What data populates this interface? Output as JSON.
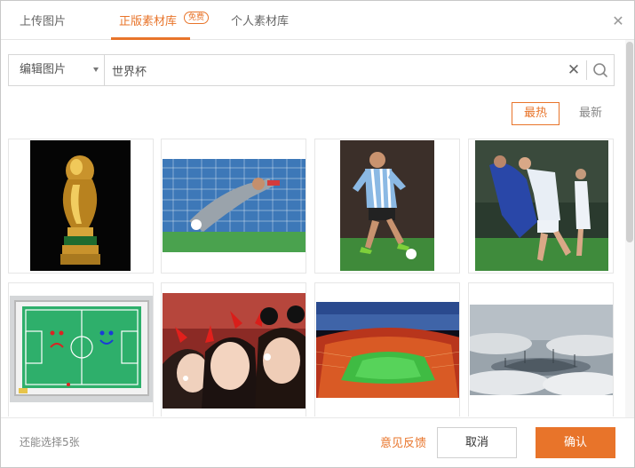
{
  "tabs": [
    {
      "label": "上传图片",
      "active": false
    },
    {
      "label": "正版素材库",
      "active": true,
      "badge": "免费"
    },
    {
      "label": "个人素材库",
      "active": false
    }
  ],
  "close_icon": "close-icon",
  "search": {
    "category": "编辑图片",
    "query": "世界杯"
  },
  "sort": {
    "hot": "最热",
    "new": "最新",
    "active": "最热"
  },
  "images": [
    {
      "subject": "world-cup-trophy"
    },
    {
      "subject": "goalkeeper-dive"
    },
    {
      "subject": "player-dribbling"
    },
    {
      "subject": "headbutt-match"
    },
    {
      "subject": "tactics-board"
    },
    {
      "subject": "fans-with-horns"
    },
    {
      "subject": "stadium-night"
    },
    {
      "subject": "stadium-in-clouds"
    }
  ],
  "footer": {
    "remaining": "还能选择5张",
    "feedback": "意见反馈",
    "cancel": "取消",
    "confirm": "确认"
  },
  "colors": {
    "accent": "#e8742a",
    "border": "#d6d6d6"
  }
}
